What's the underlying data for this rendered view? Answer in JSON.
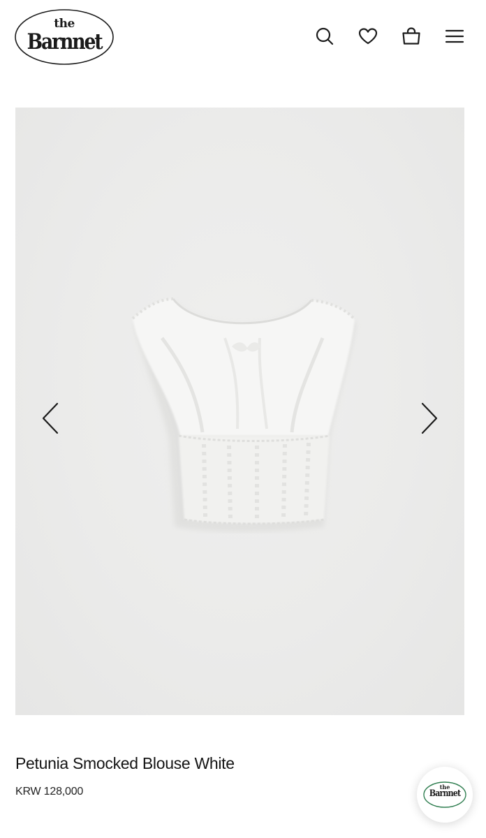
{
  "brand": {
    "logo_small": "the",
    "logo_main": "Barnnet"
  },
  "header": {
    "icons": [
      "search-icon",
      "heart-icon",
      "shopping-bag-icon",
      "menu-icon"
    ]
  },
  "gallery": {
    "product_image": "white smocked blouse",
    "prev_icon": "chevron-left-icon",
    "next_icon": "chevron-right-icon",
    "background_color": "#ebebea"
  },
  "product": {
    "title": "Petunia Smocked Blouse White",
    "price": "KRW 128,000"
  },
  "chat_button": {
    "logo_small": "the",
    "logo_main": "Barnnet"
  }
}
